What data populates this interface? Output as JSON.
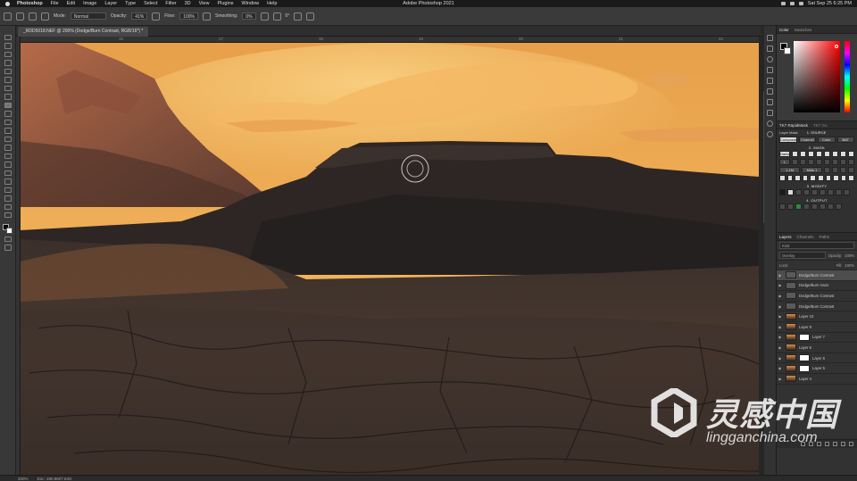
{
  "macbar": {
    "app": "Photoshop",
    "menus": [
      "File",
      "Edit",
      "Image",
      "Layer",
      "Type",
      "Select",
      "Filter",
      "3D",
      "View",
      "Plugins",
      "Window",
      "Help"
    ],
    "window_title": "Adobe Photoshop 2021",
    "clock": "Sat Sep 25  6:25 PM"
  },
  "options": {
    "mode_label": "Mode:",
    "mode_value": "Normal",
    "opacity_label": "Opacity:",
    "opacity_value": "41%",
    "flow_label": "Flow:",
    "flow_value": "100%",
    "smoothing_label": "Smoothing:",
    "smoothing_value": "0%",
    "angle_value": "0°"
  },
  "document": {
    "tab_title": "_RDD5018.NEF @ 200% (Dodge/Burn Contrast, RGB/16*) *",
    "ruler_ticks": [
      "16",
      "17",
      "18",
      "19",
      "20",
      "21",
      "22"
    ]
  },
  "status": {
    "zoom": "200%",
    "doc": "Doc: 280.9M/7.84G"
  },
  "color_panel": {
    "tabs": [
      "Color",
      "Swatches"
    ]
  },
  "raya": {
    "tabs": [
      "TK7 RapidMask",
      "TK7 Go"
    ],
    "layer_mask_label": "Layer Mask",
    "section1": "1. SOURCE",
    "source_buttons": [
      "Composite",
      "Channel",
      "Color",
      "BAT"
    ],
    "section2": "2. MASK",
    "mask_row1": [
      "Darks",
      "",
      "",
      "",
      "",
      "",
      "",
      "",
      "",
      "",
      "",
      ""
    ],
    "mask_row2": [
      "L",
      "",
      "",
      "",
      "",
      "",
      "",
      "",
      "",
      "",
      "",
      ""
    ],
    "mask_row3": [
      "1-1M",
      "",
      "",
      "",
      "Mids 1",
      "",
      "",
      "",
      "",
      "",
      "",
      ""
    ],
    "section3": "3. MODIFY",
    "section4": "4. OUTPUT"
  },
  "layers": {
    "tabs": [
      "Layers",
      "Channels",
      "Paths"
    ],
    "kind": "Kind",
    "blend": "Overlay",
    "opacity_label": "Opacity:",
    "opacity": "100%",
    "lock_label": "Lock:",
    "fill_label": "Fill:",
    "fill": "100%",
    "rows": [
      {
        "name": "Dodge/Burn Contrast",
        "type": "gray",
        "selected": true,
        "mask": false
      },
      {
        "name": "Dodge/Burn Haze",
        "type": "gray",
        "selected": false,
        "mask": false
      },
      {
        "name": "Dodge/Burn Contrast",
        "type": "gray",
        "selected": false,
        "mask": false
      },
      {
        "name": "Dodge/Burn Contrast",
        "type": "gray",
        "selected": false,
        "mask": false
      },
      {
        "name": "Layer 10",
        "type": "img",
        "selected": false,
        "mask": false
      },
      {
        "name": "Layer 9",
        "type": "img",
        "selected": false,
        "mask": false
      },
      {
        "name": "Layer 7",
        "type": "img",
        "selected": false,
        "mask": true
      },
      {
        "name": "Layer 8",
        "type": "img",
        "selected": false,
        "mask": false
      },
      {
        "name": "Layer 6",
        "type": "img",
        "selected": false,
        "mask": true
      },
      {
        "name": "Layer 5",
        "type": "img",
        "selected": false,
        "mask": true
      },
      {
        "name": "Layer 4",
        "type": "img",
        "selected": false,
        "mask": false
      }
    ]
  },
  "watermark": {
    "cn": "灵感中国",
    "en": "lingganchina.com"
  }
}
